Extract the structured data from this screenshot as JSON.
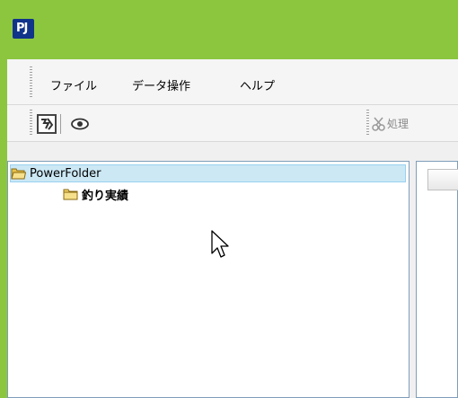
{
  "app": {
    "logo_text": "PJ"
  },
  "menubar": {
    "items": [
      {
        "label": "ファイル"
      },
      {
        "label": "データ操作"
      },
      {
        "label": "ヘルプ"
      }
    ]
  },
  "toolbar": {
    "icons": [
      "image-frame-icon",
      "eye-icon"
    ],
    "process_label": "処理"
  },
  "tree": {
    "root": {
      "label": "PowerFolder",
      "selected": true
    },
    "children": [
      {
        "label": "釣り実績"
      }
    ]
  },
  "colors": {
    "titlebar": "#8cc63f",
    "logo": "#10348a",
    "selection": "#cce8f5",
    "folder": "#f2d46b"
  }
}
